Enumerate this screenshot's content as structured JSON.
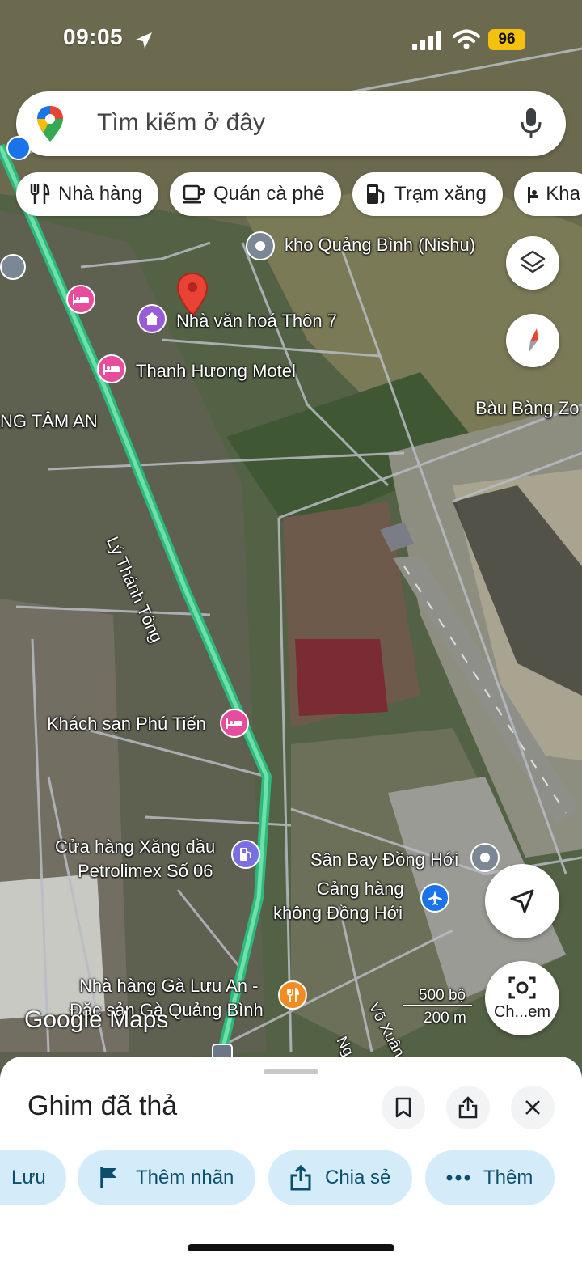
{
  "status_bar": {
    "time": "09:05",
    "battery": "96"
  },
  "search": {
    "placeholder": "Tìm kiếm ở đây"
  },
  "chips": [
    {
      "label": "Nhà hàng",
      "icon": "restaurant-icon"
    },
    {
      "label": "Quán cà phê",
      "icon": "coffee-icon"
    },
    {
      "label": "Trạm xăng",
      "icon": "gas-station-icon"
    },
    {
      "label": "Kha",
      "icon": "hotel-icon"
    }
  ],
  "map": {
    "labels": {
      "kho": "kho Quảng Bình (Nishu)",
      "nha_van_hoa": "Nhà văn hoá Thôn 7",
      "thanh_huong": "Thanh Hương Motel",
      "bau_bang": "Bàu Bàng Zo",
      "tam_an": "NG TÂM AN",
      "road": "Lý Thánh Tông",
      "phu_tien": "Khách sạn Phú Tiến",
      "xang_dau_1": "Cửa hàng Xăng dầu",
      "xang_dau_2": "Petrolimex Số 06",
      "san_bay": "Sân Bay Đồng Hới",
      "cang_1": "Cảng hàng",
      "cang_2": "không Đồng Hới",
      "nha_hang_1": "Nhà hàng Gà Lưu An -",
      "nha_hang_2": "Đặc sản Gà Quảng Bình",
      "street_vo": "Võ Xuân C",
      "street_ng": "Ng"
    },
    "scale": {
      "imperial": "500 bộ",
      "metric": "200 m"
    },
    "logo": "Google Maps",
    "camera_label": "Ch...em"
  },
  "sheet": {
    "title": "Ghim đã thả",
    "actions": [
      {
        "label": "Lưu",
        "icon": "bookmark-icon"
      },
      {
        "label": "Thêm nhãn",
        "icon": "flag-icon"
      },
      {
        "label": "Chia sẻ",
        "icon": "share-icon"
      },
      {
        "label": "Thêm",
        "icon": "more-icon"
      }
    ]
  },
  "colors": {
    "route": "#34c98a",
    "pin": "#ea4335",
    "pill_bg": "#d4ecf9",
    "pill_text": "#0b4f6c",
    "battery": "#f4c20d"
  }
}
